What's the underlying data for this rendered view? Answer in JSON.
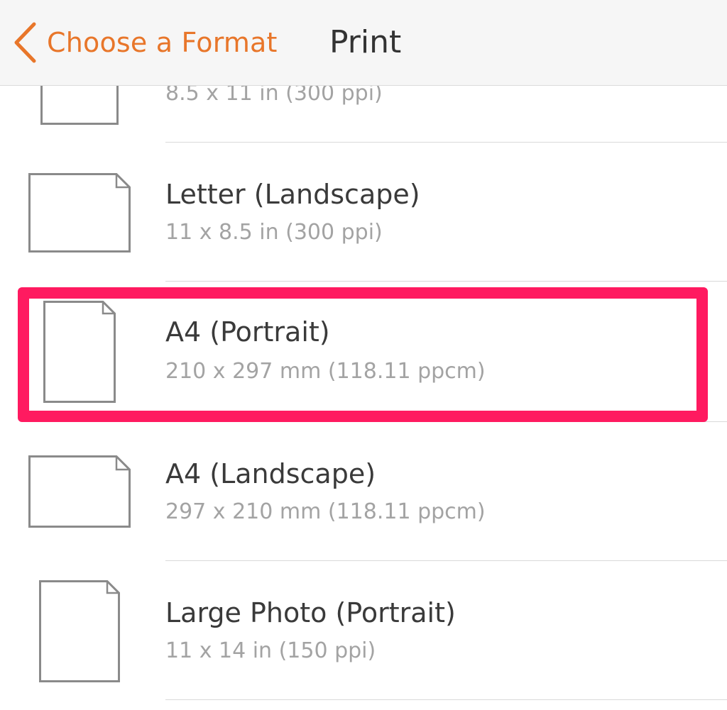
{
  "navbar": {
    "back_label": "Choose a Format",
    "title": "Print",
    "accent_color": "#e8762a"
  },
  "formats": [
    {
      "title": "",
      "detail": "8.5 x 11 in  (300 ppi)",
      "orientation": "portrait"
    },
    {
      "title": "Letter (Landscape)",
      "detail": "11 x 8.5 in  (300 ppi)",
      "orientation": "landscape"
    },
    {
      "title": "A4 (Portrait)",
      "detail": "210 x 297 mm  (118.11 ppcm)",
      "orientation": "portrait",
      "highlighted": true
    },
    {
      "title": "A4 (Landscape)",
      "detail": "297 x 210 mm  (118.11 ppcm)",
      "orientation": "landscape"
    },
    {
      "title": "Large Photo (Portrait)",
      "detail": "11 x 14 in  (150 ppi)",
      "orientation": "portrait"
    }
  ],
  "highlight_color": "#ff1a60",
  "icons": {
    "back": "chevron-left-icon",
    "page": "page-icon"
  }
}
